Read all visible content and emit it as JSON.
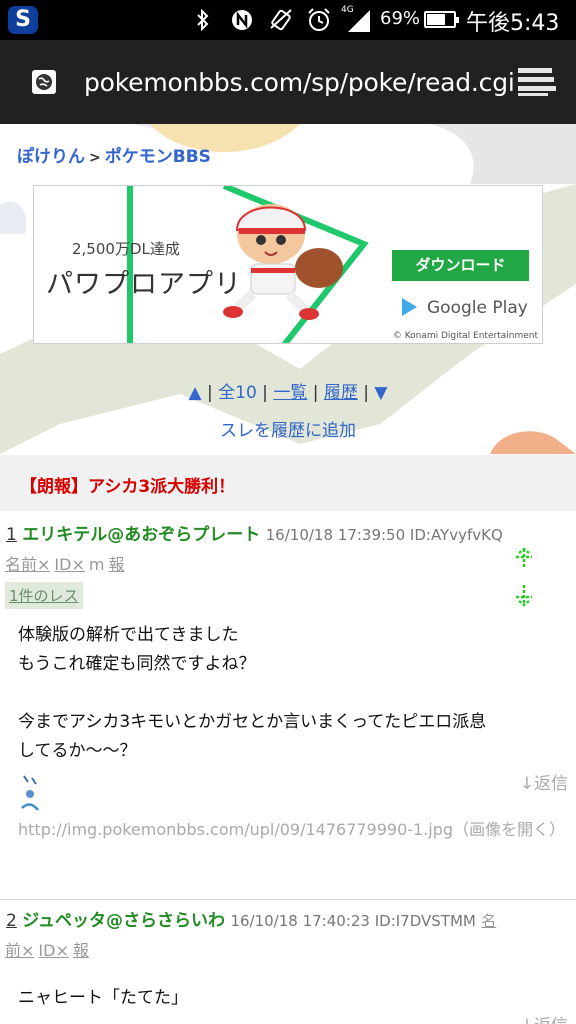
{
  "status_bar": {
    "app_logo": "S",
    "icons": [
      "bluetooth-icon",
      "nfc-icon",
      "vibrate-icon",
      "alarm-icon",
      "signal-4g-icon"
    ],
    "signal_label": "4G",
    "battery": "69%",
    "battery_level": 0.69,
    "time": "午後5:43"
  },
  "browser": {
    "url": "pokemonbbs.com/sp/poke/read.cgi"
  },
  "breadcrumb": {
    "home": "ぽけりん",
    "separator": ">",
    "board": "ポケモンBBS"
  },
  "ad": {
    "dl_count": "2,500万DL達成",
    "app_name": "パワプロアプリ",
    "download_button": "ダウンロード",
    "store": "Google Play",
    "copyright": "© Konami Digital Entertainment"
  },
  "nav": {
    "up_arrow": "▲",
    "all": "全10",
    "list": "一覧",
    "history": "履歴",
    "down_arrow": "▼",
    "add_history": "スレを履歴に追加"
  },
  "thread_title": "【朗報】アシカ3派大勝利！",
  "posts": [
    {
      "number": "1",
      "name": "エリキテル@あおぞらプレート",
      "meta": "16/10/18 17:39:50 ID:AYvyfvKQ",
      "tools": [
        "名前×",
        "ID×",
        "m",
        "報"
      ],
      "reply_count": "1件のレス",
      "body": "体験版の解析で出てきました\nもうこれ確定も同然ですよね？\n\n今までアシカ3キモいとかガセとか言いまくってたピエロ派息\nしてるか～～？",
      "reply": "↓返信",
      "image_url": "http://img.pokemonbbs.com/upl/09/1476779990-1.jpg（画像を開く）"
    },
    {
      "number": "2",
      "name": "ジュペッタ@さらさらいわ",
      "meta": "16/10/18 17:40:23 ID:I7DVSTMM",
      "meta_tail": "名",
      "tools": [
        "前×",
        "ID×",
        "報"
      ],
      "body": "ニャヒート「たてた」",
      "reply": "↓返信"
    }
  ],
  "colors": {
    "link": "#3366cc",
    "title_red": "#d60000",
    "name_green": "#228b22",
    "download_green": "#22a745"
  }
}
